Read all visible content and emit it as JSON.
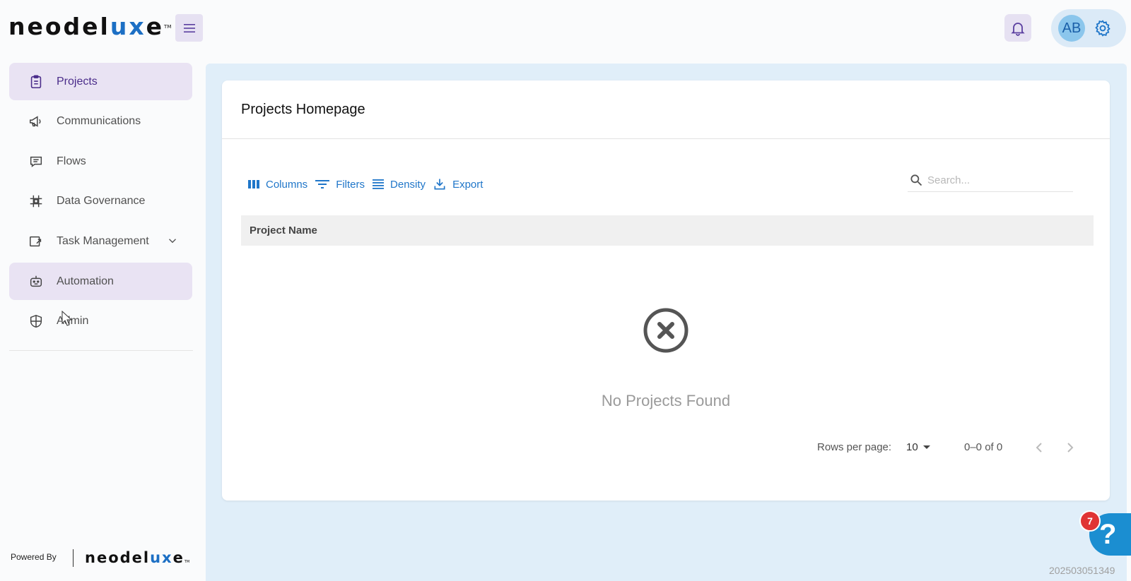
{
  "header": {
    "logo_left": "neodel",
    "logo_accent": "ux",
    "logo_right": "e",
    "logo_tm": "TM",
    "user_initials": "AB"
  },
  "sidebar": {
    "items": [
      {
        "label": "Projects",
        "icon": "clipboard-icon"
      },
      {
        "label": "Communications",
        "icon": "megaphone-icon"
      },
      {
        "label": "Flows",
        "icon": "chat-icon"
      },
      {
        "label": "Data Governance",
        "icon": "grid-icon"
      },
      {
        "label": "Task Management",
        "icon": "task-icon"
      },
      {
        "label": "Automation",
        "icon": "robot-icon"
      },
      {
        "label": "Admin",
        "icon": "shield-icon"
      }
    ],
    "powered_by": "Powered By",
    "powered_logo_left": "neodel",
    "powered_logo_accent": "ux",
    "powered_logo_right": "e",
    "powered_logo_tm": "TM"
  },
  "main": {
    "title": "Projects Homepage",
    "toolbar": {
      "columns": "Columns",
      "filters": "Filters",
      "density": "Density",
      "export": "Export"
    },
    "search_placeholder": "Search...",
    "column_header": "Project Name",
    "empty_message": "No Projects Found",
    "pagination": {
      "rows_label": "Rows per page:",
      "rows_value": "10",
      "range": "0–0 of 0"
    }
  },
  "help": {
    "badge": "7",
    "glyph": "?"
  },
  "build_id": "202503051349",
  "colors": {
    "accent": "#1f76c9",
    "active_nav": "#e9e3f3",
    "content_bg": "#e0eef9",
    "badge": "#e03434"
  }
}
